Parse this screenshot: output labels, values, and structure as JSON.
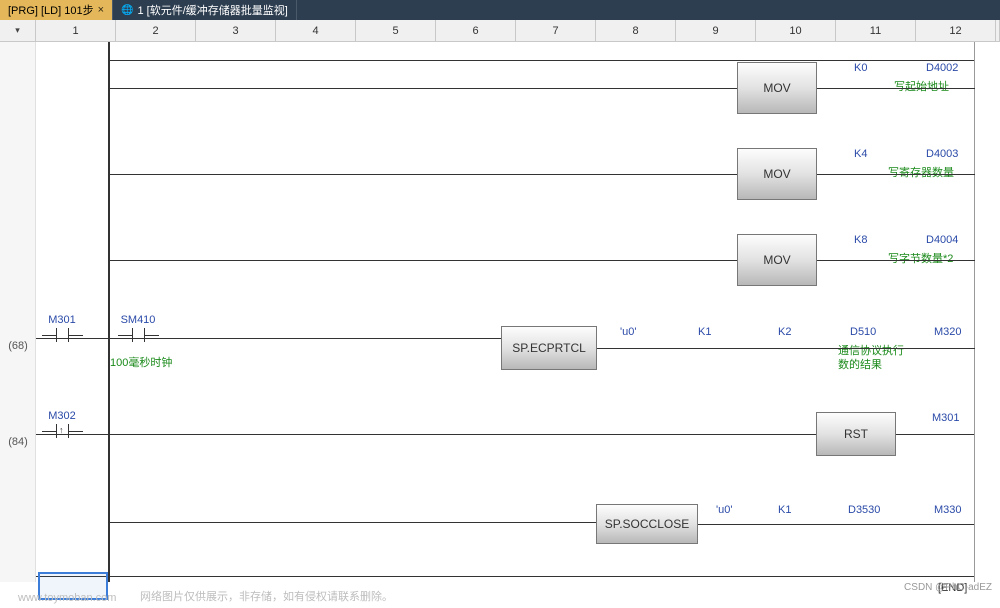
{
  "tabs": [
    {
      "label": "[PRG] [LD] 101步",
      "active": true
    },
    {
      "label": "1 [软元件/缓冲存储器批量监视]",
      "active": false
    }
  ],
  "ruler": [
    "1",
    "2",
    "3",
    "4",
    "5",
    "6",
    "7",
    "8",
    "9",
    "10",
    "11",
    "12"
  ],
  "mov_rows": [
    {
      "p1": "K0",
      "p2": "D4002",
      "comment": "写起始地址"
    },
    {
      "p1": "K4",
      "p2": "D4003",
      "comment": "写寄存器数量"
    },
    {
      "p1": "K8",
      "p2": "D4004",
      "comment": "写字节数量*2"
    }
  ],
  "rung68": {
    "step": "(68)",
    "contact1": "M301",
    "contact2": "SM410",
    "contact2_comment": "100毫秒时钟",
    "inst": "SP.ECPRTCL",
    "params": [
      "'u0'",
      "K1",
      "K2",
      "D510",
      "M320"
    ],
    "result_comment_l1": "通信协议执行",
    "result_comment_l2": "数的结果"
  },
  "rung84": {
    "step": "(84)",
    "contact": "M302",
    "inst_rst": "RST",
    "rst_param": "M301",
    "inst_close": "SP.SOCCLOSE",
    "close_params": [
      "'u0'",
      "K1",
      "D3530",
      "M330"
    ]
  },
  "end_label": "[END]",
  "corner_text": "CSDN @PhC-adEZ",
  "watermark": "www.toymoban.com",
  "footer_note": "网络图片仅供展示，非存储，如有侵权请联系删除。"
}
